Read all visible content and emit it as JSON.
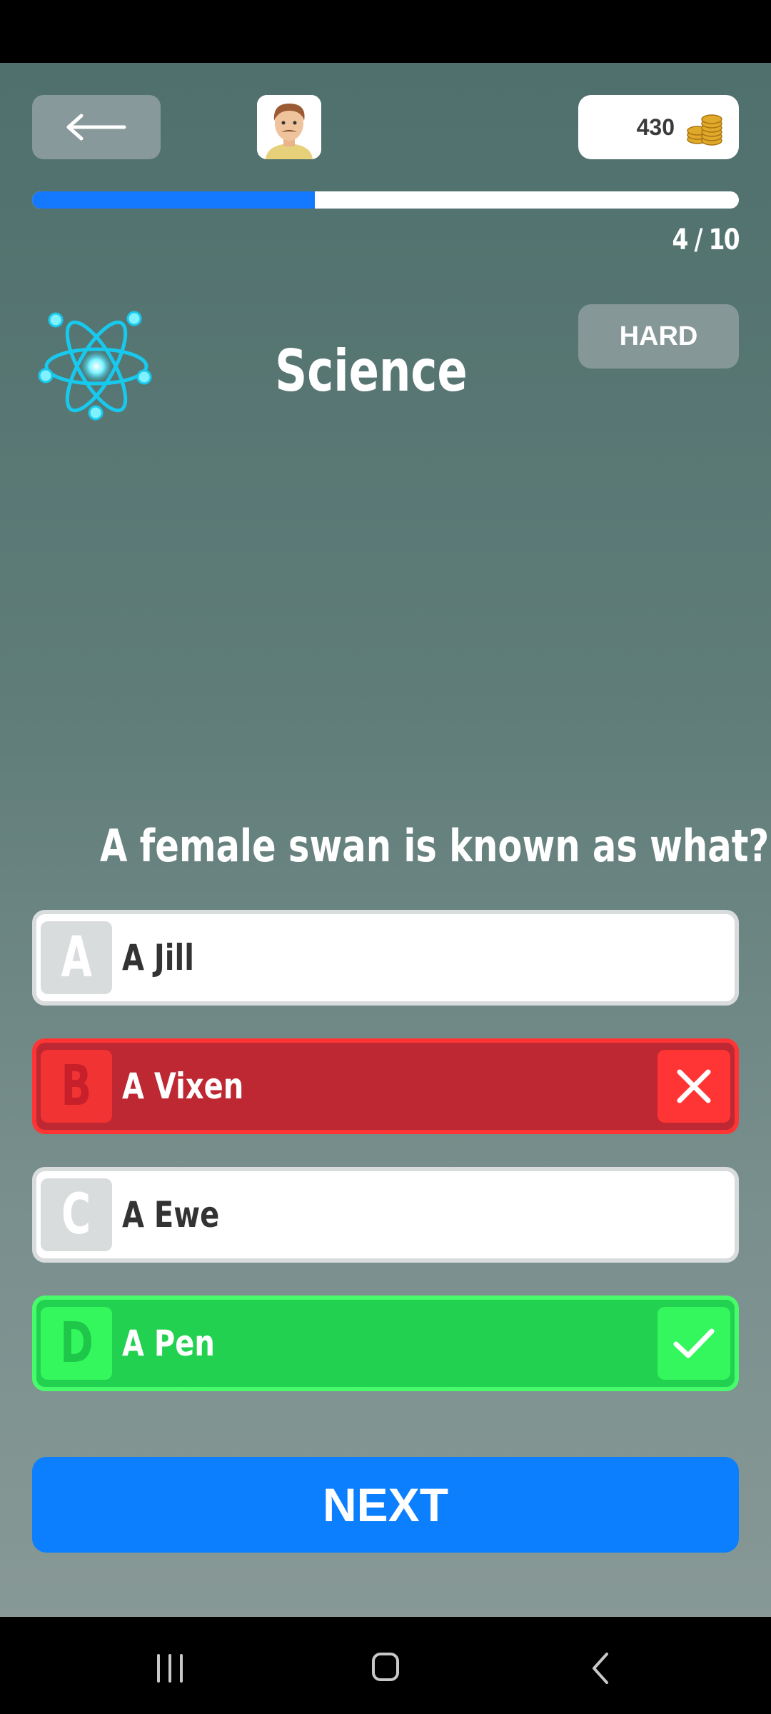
{
  "header": {
    "coins": "430"
  },
  "progress": {
    "text": "4 / 10",
    "fraction": 0.4
  },
  "category": {
    "title": "Science",
    "difficulty": "HARD",
    "icon": "atom-icon"
  },
  "question": {
    "text": "A female swan is known as what?"
  },
  "answers": [
    {
      "letter": "A",
      "text": "A Jill",
      "state": "neutral"
    },
    {
      "letter": "B",
      "text": "A Vixen",
      "state": "wrong"
    },
    {
      "letter": "C",
      "text": "A Ewe",
      "state": "neutral"
    },
    {
      "letter": "D",
      "text": "A Pen",
      "state": "correct"
    }
  ],
  "next_button": {
    "label": "NEXT"
  },
  "colors": {
    "accent": "#0b7ffd",
    "wrong": "#bd2832",
    "correct": "#22d150"
  }
}
